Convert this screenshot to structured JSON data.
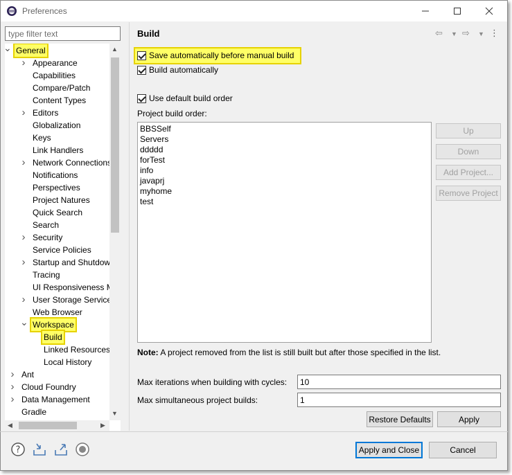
{
  "window": {
    "title": "Preferences"
  },
  "filter": {
    "placeholder": "type filter text"
  },
  "tree": {
    "general": "General",
    "general_children": [
      "Appearance",
      "Capabilities",
      "Compare/Patch",
      "Content Types",
      "Editors",
      "Globalization",
      "Keys",
      "Link Handlers",
      "Network Connections",
      "Notifications",
      "Perspectives",
      "Project Natures",
      "Quick Search",
      "Search",
      "Security",
      "Service Policies",
      "Startup and Shutdown",
      "Tracing",
      "UI Responsiveness M",
      "User Storage Service",
      "Web Browser"
    ],
    "workspace": "Workspace",
    "workspace_children": [
      "Build",
      "Linked Resources",
      "Local History"
    ],
    "top_level": [
      "Ant",
      "Cloud Foundry",
      "Data Management",
      "Gradle"
    ]
  },
  "page": {
    "title": "Build",
    "save_before_build": "Save automatically before manual build",
    "build_automatically": "Build automatically",
    "use_default_order": "Use default build order",
    "order_label": "Project build order:",
    "projects": [
      "BBSSelf",
      "Servers",
      "ddddd",
      "forTest",
      "info",
      "javaprj",
      "myhome",
      "test"
    ],
    "btn_up": "Up",
    "btn_down": "Down",
    "btn_add": "Add Project...",
    "btn_remove": "Remove Project",
    "note_bold": "Note:",
    "note_text": "A project removed from the list is still built but after those specified in the list.",
    "max_iter_label": "Max iterations when building with cycles:",
    "max_iter_value": "10",
    "max_sim_label": "Max simultaneous project builds:",
    "max_sim_value": "1",
    "restore_defaults": "Restore Defaults",
    "apply": "Apply"
  },
  "footer": {
    "apply_close": "Apply and Close",
    "cancel": "Cancel"
  },
  "colors": {
    "highlight": "#ffff66",
    "highlight_border": "#e6d200",
    "primary_border": "#0078d7"
  }
}
